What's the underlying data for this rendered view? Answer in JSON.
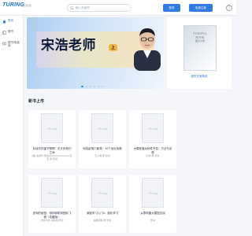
{
  "header": {
    "logo_text": "TURING",
    "logo_sub": "图灵社区",
    "search_placeholder": "输入关键词",
    "login_label": "登录",
    "register_label": "免费注册",
    "help_label": "?"
  },
  "sidebar": {
    "items": [
      {
        "label": "首页",
        "icon": "home-icon",
        "active": true
      },
      {
        "label": "图书",
        "icon": "book-icon",
        "active": false
      },
      {
        "label": "图书/免费读",
        "icon": "reader-icon",
        "active": false
      }
    ]
  },
  "banner": {
    "title": "宋浩老师",
    "tag": "上",
    "slides": 6,
    "active_slide": 1
  },
  "feature": {
    "cover_brand": "TURING",
    "cover_name": "BOOK",
    "cover_cn": "图灵文库",
    "caption": "图灵文库精选",
    "sub": ""
  },
  "new_books": {
    "title": "新书上市",
    "watermark": "iTuring",
    "items": [
      {
        "title": "对话中的量子物理：天才的你们之间",
        "meta": "[美] 爱德华·赫塞尔(Samuel Decker)  尼克 译  纸书"
      },
      {
        "title": "科技影响力新秀：10个创业传奇",
        "meta": "王小明 著  纸书"
      },
      {
        "title": "大模型驱动软件开发：方法与实践",
        "meta": "刘洋 著  纸书"
      },
      {
        "title": "咨询的秘密：带你和职场团队飞驰（珍藏版）",
        "meta": "杰拉尔德·温伯格  纸书"
      },
      {
        "title": "深度学习入门4：强化学习",
        "meta": "斋藤康毅 著  纸书"
      },
      {
        "title": "从零构建大模型应用",
        "meta": "纸书"
      }
    ]
  }
}
